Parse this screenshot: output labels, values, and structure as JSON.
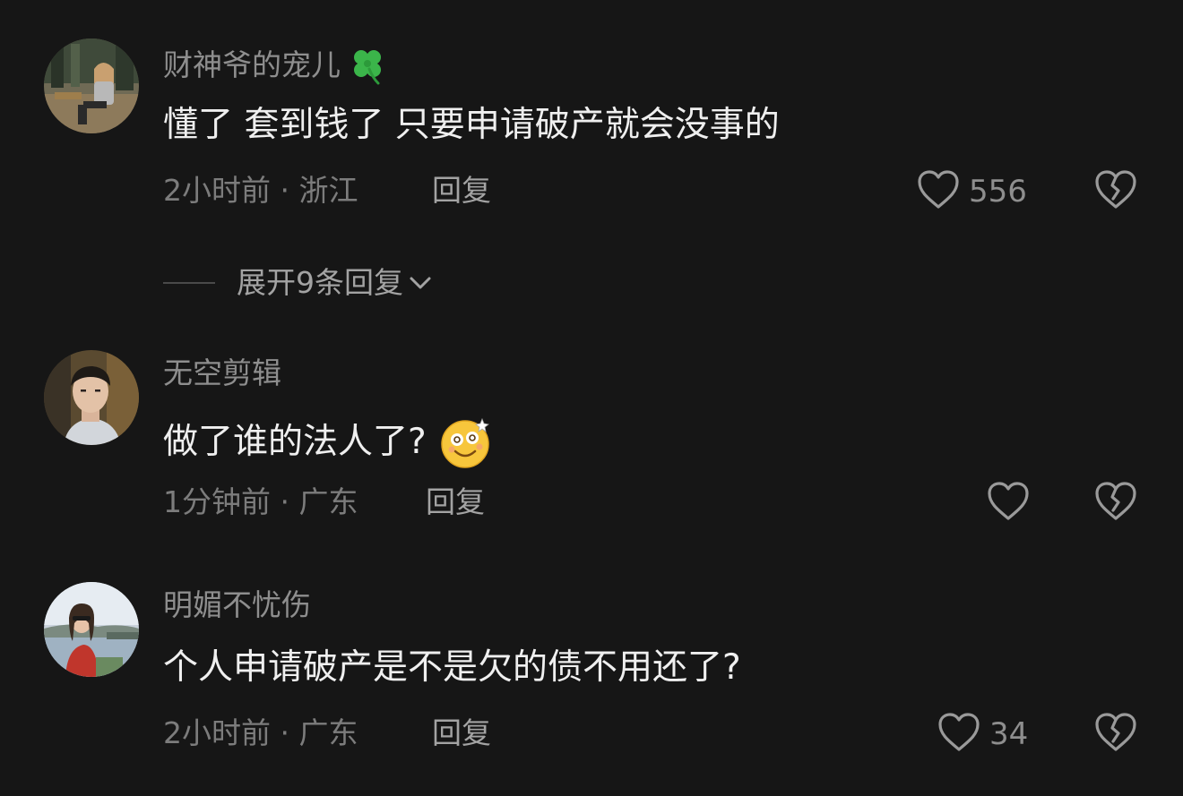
{
  "comments": [
    {
      "username": "财神爷的宠儿",
      "badge_icon": "four-leaf-clover-icon",
      "text": "懂了 套到钱了 只要申请破产就会没事的",
      "time_location": "2小时前 · 浙江",
      "reply_label": "回复",
      "like_count": "556",
      "expand_replies": "展开9条回复"
    },
    {
      "username": "无空剪辑",
      "text": "做了谁的法人了?",
      "emoji_icon": "dizzy-smile-emoji-icon",
      "time_location": "1分钟前 · 广东",
      "reply_label": "回复",
      "like_count": ""
    },
    {
      "username": "明媚不忧伤",
      "text": "个人申请破产是不是欠的债不用还了?",
      "time_location": "2小时前 · 广东",
      "reply_label": "回复",
      "like_count": "34"
    }
  ],
  "colors": {
    "background": "#161616",
    "username": "#8e8e8e",
    "text": "#efefef",
    "meta": "#7c7c7c"
  }
}
